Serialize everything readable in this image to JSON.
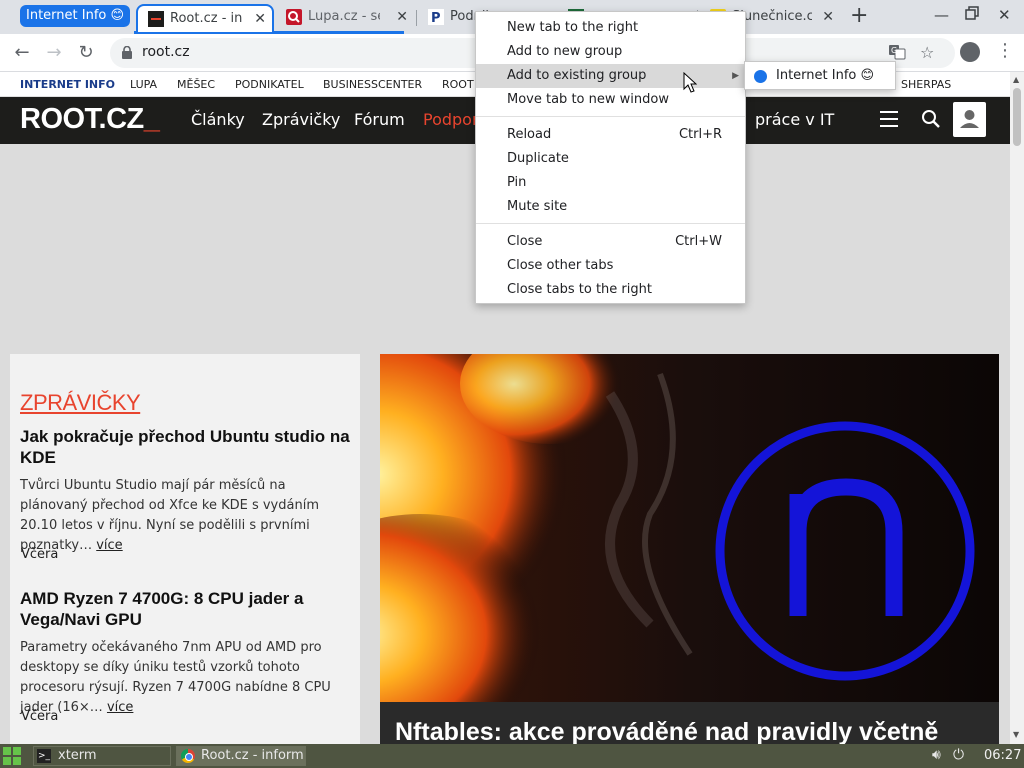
{
  "browser": {
    "group_chip": "Internet Info 😊",
    "tabs": [
      {
        "title": "Root.cz - inf"
      },
      {
        "title": "Lupa.cz - se"
      },
      {
        "title": "Podnikatel"
      },
      {
        "title": ""
      },
      {
        "title": "Slunečnice.c"
      }
    ],
    "url": "root.cz"
  },
  "network_bar": {
    "items": [
      "INTERNET INFO",
      "LUPA",
      "MĚŠEC",
      "PODNIKATEL",
      "BUSINESSCENTER",
      "ROOT",
      "SHERPAS"
    ]
  },
  "site": {
    "logo_main": "ROOT.CZ",
    "logo_mark": "_",
    "nav": [
      "Články",
      "Zprávičky",
      "Fórum",
      "Podpora",
      "práce v IT"
    ],
    "section_label": "ZPRÁVIČKY",
    "articles": [
      {
        "title": "Jak pokračuje přechod Ubuntu studio na KDE",
        "perex": "Tvůrci Ubuntu Studio mají pár měsíců na plánovaný přechod od Xfce ke KDE s vydáním 20.10 letos v říjnu. Nyní se podělili s prvními poznatky…",
        "more": "více",
        "date": "Včera"
      },
      {
        "title": "AMD Ryzen 7 4700G: 8 CPU jader a Vega/Navi GPU",
        "perex": "Parametry očekávaného 7nm APU od AMD pro desktopy se díky úniku testů vzorků tohoto procesoru rýsují. Ryzen 7 4700G nabídne 8 CPU jader (16×…",
        "more": "více",
        "date": "Včera"
      }
    ],
    "hero_title": "Nftables: akce prováděné nad pravidly včetně",
    "hero_logo_letter": "n"
  },
  "context_menu": {
    "items": [
      {
        "label": "New tab to the right",
        "shortcut": ""
      },
      {
        "label": "Add to new group",
        "shortcut": ""
      },
      {
        "label": "Add to existing group",
        "shortcut": "",
        "submenu": true,
        "highlighted": true
      },
      {
        "label": "Move tab to new window",
        "shortcut": ""
      },
      {
        "label": "Reload",
        "shortcut": "Ctrl+R"
      },
      {
        "label": "Duplicate",
        "shortcut": ""
      },
      {
        "label": "Pin",
        "shortcut": ""
      },
      {
        "label": "Mute site",
        "shortcut": ""
      },
      {
        "label": "Close",
        "shortcut": "Ctrl+W"
      },
      {
        "label": "Close other tabs",
        "shortcut": ""
      },
      {
        "label": "Close tabs to the right",
        "shortcut": ""
      }
    ],
    "submenu_item": "Internet Info 😊"
  },
  "taskbar": {
    "tasks": [
      "xterm",
      "Root.cz - inform"
    ],
    "clock": "06:27"
  },
  "colors": {
    "accent_blue": "#1a73e8",
    "root_red": "#e8442e",
    "header_dark": "#1d1d1b",
    "taskbar": "#4f5541"
  }
}
